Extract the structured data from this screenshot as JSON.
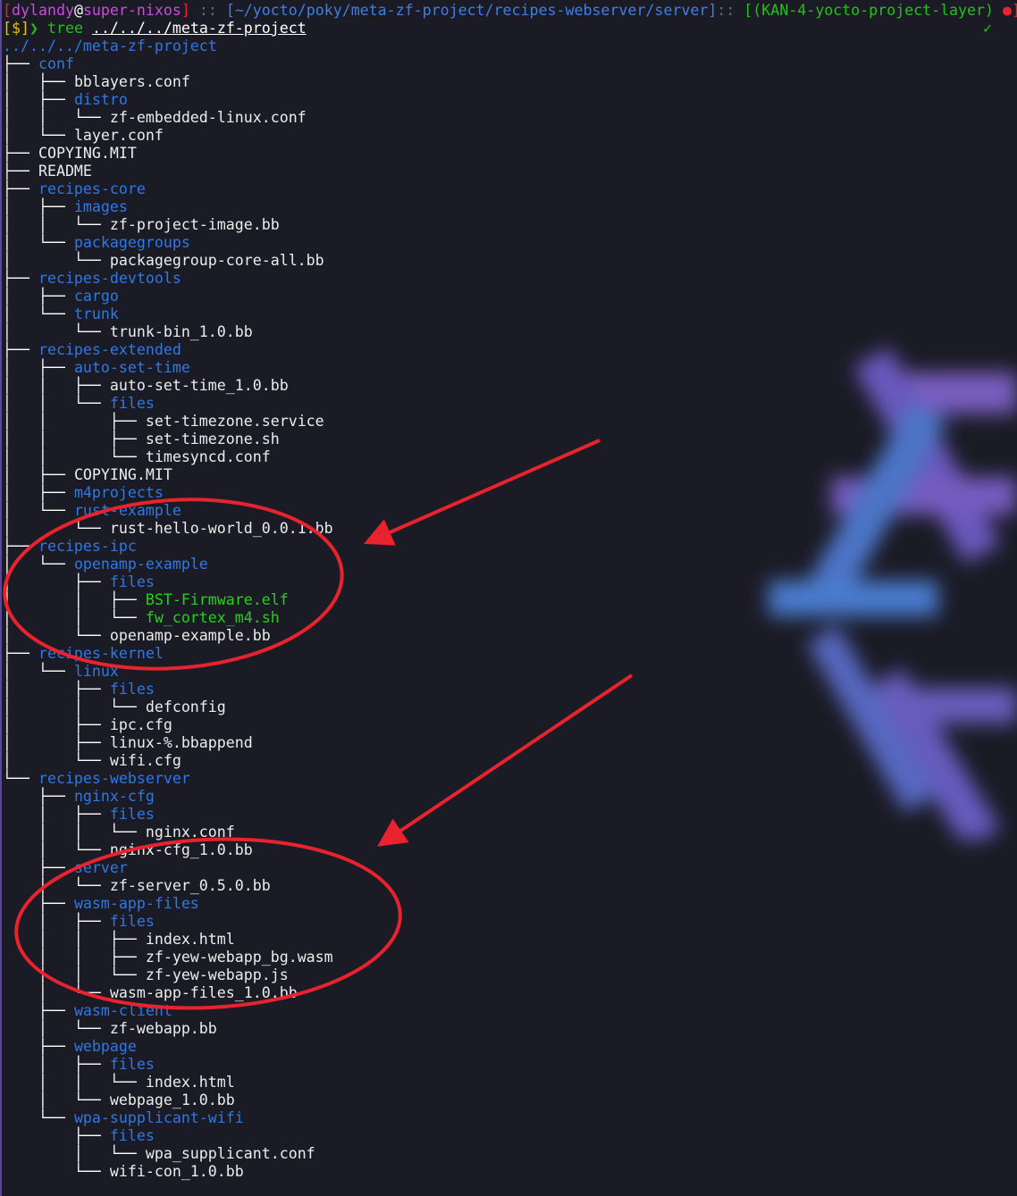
{
  "theme": {
    "background": "#1b1b26",
    "directory_color": "#2f78e4",
    "file_color": "#ececec",
    "executable_color": "#22d316",
    "annotation_color": "#e8232e"
  },
  "prompt": {
    "open_bracket": "[",
    "user": "dylandy",
    "at": "@",
    "host": "super-nixos",
    "close_bracket": "]",
    "separator": "::",
    "path": "[~/yocto/poky/meta-zf-project/recipes-webserver/server]",
    "branch": "[(KAN-4-yocto-project-layer)",
    "dirty_marker": "●]",
    "check_mark": "✓",
    "symbol": "[$]",
    "arrow": "❯",
    "command": "tree",
    "argument": "../../../meta-zf-project"
  },
  "tree": {
    "root": "../../../meta-zf-project",
    "lines": [
      {
        "prefix": "├── ",
        "name": "conf",
        "kind": "dir"
      },
      {
        "prefix": "│   ├── ",
        "name": "bblayers.conf",
        "kind": "file"
      },
      {
        "prefix": "│   ├── ",
        "name": "distro",
        "kind": "dir"
      },
      {
        "prefix": "│   │   └── ",
        "name": "zf-embedded-linux.conf",
        "kind": "file"
      },
      {
        "prefix": "│   └── ",
        "name": "layer.conf",
        "kind": "file"
      },
      {
        "prefix": "├── ",
        "name": "COPYING.MIT",
        "kind": "file"
      },
      {
        "prefix": "├── ",
        "name": "README",
        "kind": "file"
      },
      {
        "prefix": "├── ",
        "name": "recipes-core",
        "kind": "dir"
      },
      {
        "prefix": "│   ├── ",
        "name": "images",
        "kind": "dir"
      },
      {
        "prefix": "│   │   └── ",
        "name": "zf-project-image.bb",
        "kind": "file"
      },
      {
        "prefix": "│   └── ",
        "name": "packagegroups",
        "kind": "dir"
      },
      {
        "prefix": "│       └── ",
        "name": "packagegroup-core-all.bb",
        "kind": "file"
      },
      {
        "prefix": "├── ",
        "name": "recipes-devtools",
        "kind": "dir"
      },
      {
        "prefix": "│   ├── ",
        "name": "cargo",
        "kind": "dir"
      },
      {
        "prefix": "│   └── ",
        "name": "trunk",
        "kind": "dir"
      },
      {
        "prefix": "│       └── ",
        "name": "trunk-bin_1.0.bb",
        "kind": "file"
      },
      {
        "prefix": "├── ",
        "name": "recipes-extended",
        "kind": "dir"
      },
      {
        "prefix": "│   ├── ",
        "name": "auto-set-time",
        "kind": "dir"
      },
      {
        "prefix": "│   │   ├── ",
        "name": "auto-set-time_1.0.bb",
        "kind": "file"
      },
      {
        "prefix": "│   │   └── ",
        "name": "files",
        "kind": "dir"
      },
      {
        "prefix": "│   │       ├── ",
        "name": "set-timezone.service",
        "kind": "file"
      },
      {
        "prefix": "│   │       ├── ",
        "name": "set-timezone.sh",
        "kind": "file"
      },
      {
        "prefix": "│   │       └── ",
        "name": "timesyncd.conf",
        "kind": "file"
      },
      {
        "prefix": "│   ├── ",
        "name": "COPYING.MIT",
        "kind": "file"
      },
      {
        "prefix": "│   ├── ",
        "name": "m4projects",
        "kind": "dir"
      },
      {
        "prefix": "│   └── ",
        "name": "rust-example",
        "kind": "dir"
      },
      {
        "prefix": "│       └── ",
        "name": "rust-hello-world_0.0.1.bb",
        "kind": "file"
      },
      {
        "prefix": "├── ",
        "name": "recipes-ipc",
        "kind": "dir"
      },
      {
        "prefix": "│   └── ",
        "name": "openamp-example",
        "kind": "dir"
      },
      {
        "prefix": "│       ├── ",
        "name": "files",
        "kind": "dir"
      },
      {
        "prefix": "│       │   ├── ",
        "name": "BST-Firmware.elf",
        "kind": "exec"
      },
      {
        "prefix": "│       │   └── ",
        "name": "fw_cortex_m4.sh",
        "kind": "exec"
      },
      {
        "prefix": "│       └── ",
        "name": "openamp-example.bb",
        "kind": "file"
      },
      {
        "prefix": "├── ",
        "name": "recipes-kernel",
        "kind": "dir"
      },
      {
        "prefix": "│   └── ",
        "name": "linux",
        "kind": "dir"
      },
      {
        "prefix": "│       ├── ",
        "name": "files",
        "kind": "dir"
      },
      {
        "prefix": "│       │   └── ",
        "name": "defconfig",
        "kind": "file"
      },
      {
        "prefix": "│       ├── ",
        "name": "ipc.cfg",
        "kind": "file"
      },
      {
        "prefix": "│       ├── ",
        "name": "linux-%.bbappend",
        "kind": "file"
      },
      {
        "prefix": "│       └── ",
        "name": "wifi.cfg",
        "kind": "file"
      },
      {
        "prefix": "└── ",
        "name": "recipes-webserver",
        "kind": "dir"
      },
      {
        "prefix": "    ├── ",
        "name": "nginx-cfg",
        "kind": "dir"
      },
      {
        "prefix": "    │   ├── ",
        "name": "files",
        "kind": "dir"
      },
      {
        "prefix": "    │   │   └── ",
        "name": "nginx.conf",
        "kind": "file"
      },
      {
        "prefix": "    │   └── ",
        "name": "nginx-cfg_1.0.bb",
        "kind": "file"
      },
      {
        "prefix": "    ├── ",
        "name": "server",
        "kind": "dir"
      },
      {
        "prefix": "    │   └── ",
        "name": "zf-server_0.5.0.bb",
        "kind": "file"
      },
      {
        "prefix": "    ├── ",
        "name": "wasm-app-files",
        "kind": "dir"
      },
      {
        "prefix": "    │   ├── ",
        "name": "files",
        "kind": "dir"
      },
      {
        "prefix": "    │   │   ├── ",
        "name": "index.html",
        "kind": "file"
      },
      {
        "prefix": "    │   │   ├── ",
        "name": "zf-yew-webapp_bg.wasm",
        "kind": "file"
      },
      {
        "prefix": "    │   │   └── ",
        "name": "zf-yew-webapp.js",
        "kind": "file"
      },
      {
        "prefix": "    │   └── ",
        "name": "wasm-app-files_1.0.bb",
        "kind": "file"
      },
      {
        "prefix": "    ├── ",
        "name": "wasm-client",
        "kind": "dir"
      },
      {
        "prefix": "    │   └── ",
        "name": "zf-webapp.bb",
        "kind": "file"
      },
      {
        "prefix": "    ├── ",
        "name": "webpage",
        "kind": "dir"
      },
      {
        "prefix": "    │   ├── ",
        "name": "files",
        "kind": "dir"
      },
      {
        "prefix": "    │   │   └── ",
        "name": "index.html",
        "kind": "file"
      },
      {
        "prefix": "    │   └── ",
        "name": "webpage_1.0.bb",
        "kind": "file"
      },
      {
        "prefix": "    └── ",
        "name": "wpa-supplicant-wifi",
        "kind": "dir"
      },
      {
        "prefix": "        ├── ",
        "name": "files",
        "kind": "dir"
      },
      {
        "prefix": "        │   └── ",
        "name": "wpa_supplicant.conf",
        "kind": "file"
      },
      {
        "prefix": "        └── ",
        "name": "wifi-con_1.0.bb",
        "kind": "file"
      }
    ]
  },
  "wallpaper": {
    "icon": "nixos-snowflake-icon",
    "colors": [
      "#7e62c8",
      "#4f7ad0",
      "#6a5fc6"
    ]
  }
}
